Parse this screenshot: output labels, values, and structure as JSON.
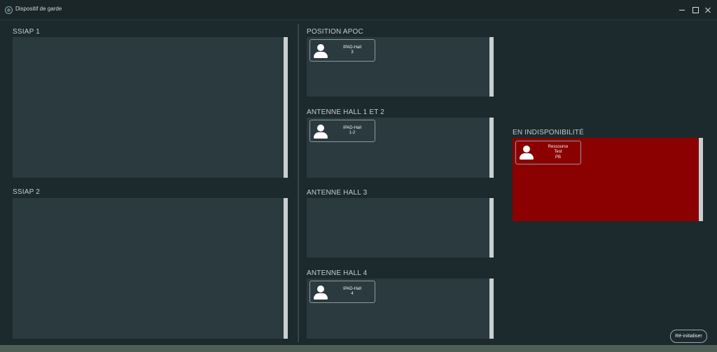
{
  "window": {
    "title": "Dispositif de garde",
    "app_icon": "app-logo-icon"
  },
  "zones": {
    "ssiap1": {
      "title": "SSIAP 1",
      "cards": []
    },
    "ssiap2": {
      "title": "SSIAP 2",
      "cards": []
    },
    "position_apoc": {
      "title": "POSITION APOC",
      "cards": [
        {
          "line1": "IPAD-Hall",
          "line2": "3"
        }
      ]
    },
    "antenne_hall_1_2": {
      "title": "ANTENNE HALL 1 ET 2",
      "cards": [
        {
          "line1": "IPAD-Hall",
          "line2": "1-2"
        }
      ]
    },
    "antenne_hall_3": {
      "title": "ANTENNE HALL 3",
      "cards": []
    },
    "antenne_hall_4": {
      "title": "ANTENNE HALL 4",
      "cards": [
        {
          "line1": "IPAD-Hall",
          "line2": "4"
        }
      ]
    },
    "indisponibilite": {
      "title": "EN INDISPONIBILITÉ",
      "cards": [
        {
          "line1": "Ressource",
          "line2": "Test",
          "line3": "PB"
        }
      ]
    }
  },
  "actions": {
    "reset_label": "Ré-initialiser"
  },
  "colors": {
    "background": "#1c292d",
    "zone": "#2a3a3e",
    "unavailable_zone": "#8b0000",
    "scrollbar": "#c9cfd1"
  }
}
